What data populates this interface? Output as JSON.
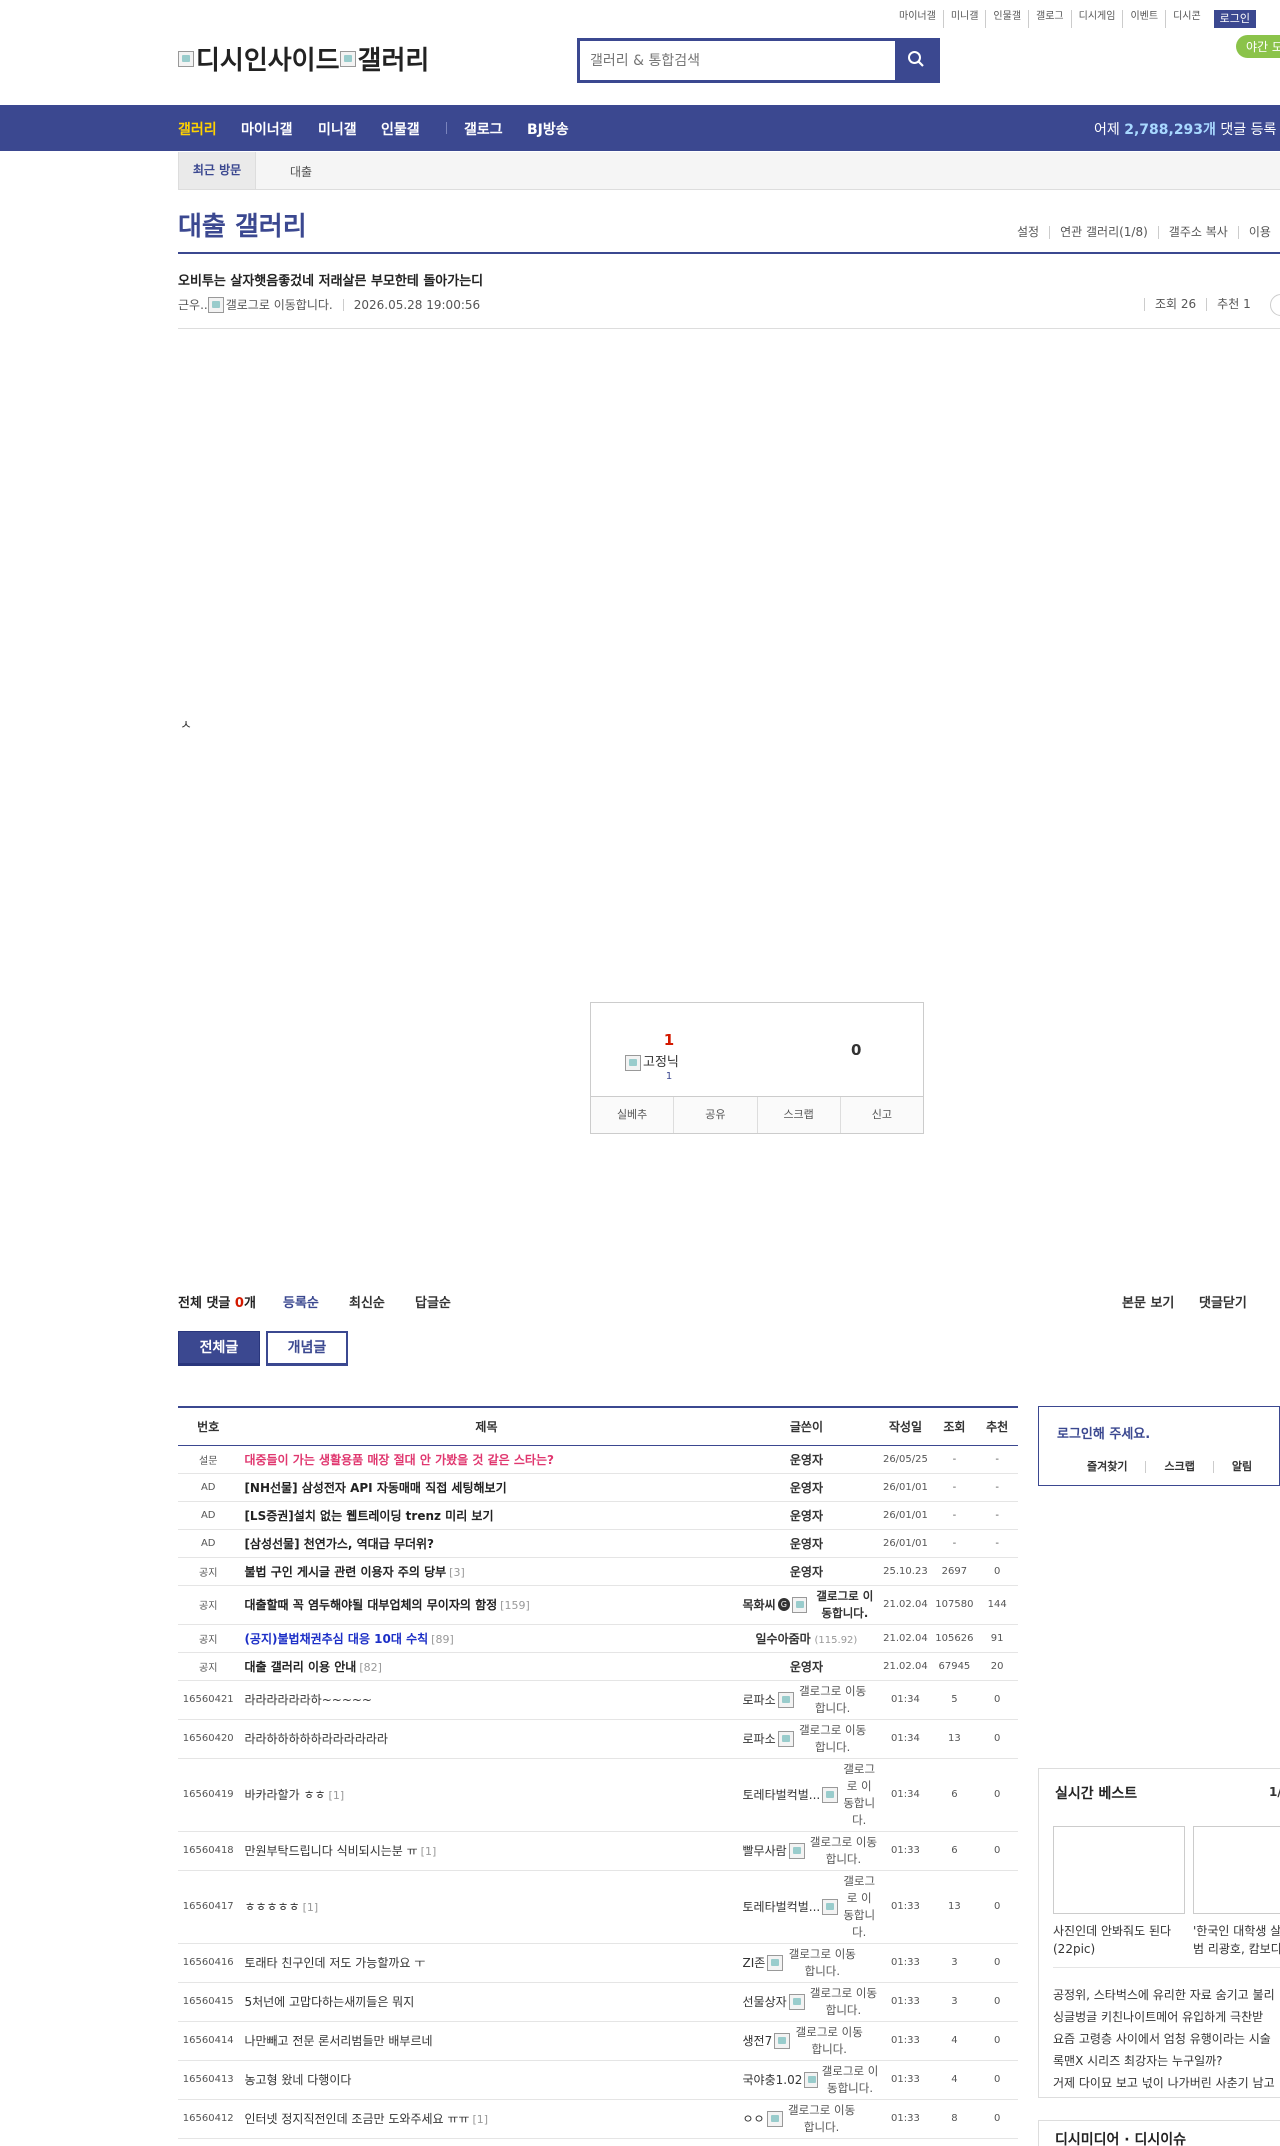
{
  "util_links": [
    "마이너갤",
    "미니갤",
    "인물갤",
    "갤로그",
    "디시게임",
    "이벤트",
    "디시콘"
  ],
  "login_label": "로그인",
  "logo": {
    "alt1": "디시인사이드",
    "alt2": "갤러리"
  },
  "search": {
    "placeholder": "갤러리 & 통합검색"
  },
  "night_mode": "야간 모",
  "gnb": {
    "items": [
      "갤러리",
      "마이너갤",
      "미니갤",
      "인물갤",
      "갤로그",
      "BJ방송"
    ],
    "stat_prefix": "어제",
    "stat_value": "2,788,293개",
    "stat_suffix": "댓글 등록"
  },
  "recent": {
    "label": "최근 방문",
    "items": [
      "대출"
    ]
  },
  "gallery": {
    "title": "대출 갤러리",
    "options": [
      "설정",
      "연관 갤러리(1/8)",
      "갤주소 복사",
      "이용"
    ]
  },
  "post": {
    "title": "오비투는 살자햇음좋겄네 저래살믄 부모한테 돌아가는디",
    "writer": "근우..",
    "writer_icon_alt": "갤로그로 이동합니다.",
    "date": "2026.05.28 19:00:56",
    "views": "조회 26",
    "recommend": "추천 1",
    "body": "ㅅ"
  },
  "vote": {
    "up_count": "1",
    "fixed_alt": "고정닉",
    "fixed_count": "1",
    "down_count": "0",
    "buttons": [
      "실베추",
      "공유",
      "스크랩",
      "신고"
    ]
  },
  "comments": {
    "total_label": "전체 댓글",
    "total_count": "0",
    "total_unit": "개",
    "sorts": [
      "등록순",
      "최신순",
      "답글순"
    ],
    "right": [
      "본문 보기",
      "댓글닫기"
    ]
  },
  "tabs": {
    "all": "전체글",
    "recommend": "개념글"
  },
  "list": {
    "headers": [
      "번호",
      "제목",
      "글쓴이",
      "작성일",
      "조회",
      "추천"
    ],
    "rows": [
      {
        "num": "설문",
        "subject": "대중들이 가는 생활용품 매장 절대 안 가봤을 것 같은 스타는?",
        "reply": "",
        "style": "pink",
        "writer": "운영자",
        "wb": true,
        "ip": "",
        "icon": "",
        "date": "26/05/25",
        "views": "-",
        "rec": "-"
      },
      {
        "num": "AD",
        "subject": "[NH선물] 삼성전자 API 자동매매 직접 세팅해보기",
        "reply": "",
        "style": "b",
        "writer": "운영자",
        "wb": true,
        "ip": "",
        "icon": "",
        "date": "26/01/01",
        "views": "-",
        "rec": "-"
      },
      {
        "num": "AD",
        "subject": "[LS증권]설치 없는 웹트레이딩 trenz 미리 보기",
        "reply": "",
        "style": "b",
        "writer": "운영자",
        "wb": true,
        "ip": "",
        "icon": "",
        "date": "26/01/01",
        "views": "-",
        "rec": "-"
      },
      {
        "num": "AD",
        "subject": "[삼성선물] 천연가스, 역대급 무더위?",
        "reply": "",
        "style": "b",
        "writer": "운영자",
        "wb": true,
        "ip": "",
        "icon": "",
        "date": "26/01/01",
        "views": "-",
        "rec": "-"
      },
      {
        "num": "공지",
        "subject": "불법 구인 게시글 관련 이용자 주의 당부",
        "reply": "[3]",
        "style": "b",
        "writer": "운영자",
        "wb": true,
        "ip": "",
        "icon": "",
        "date": "25.10.23",
        "views": "2697",
        "rec": "0"
      },
      {
        "num": "공지",
        "subject": "대출할때 꼭 염두해야될 대부업체의 무이자의 함정",
        "reply": "[159]",
        "style": "b",
        "writer": "목화씨",
        "wb": true,
        "ip": "",
        "icon": "갤로그로 이동합니다.",
        "iconb": true,
        "date": "21.02.04",
        "views": "107580",
        "rec": "144"
      },
      {
        "num": "공지",
        "subject": "(공지)불법채권추심 대응 10대 수칙",
        "reply": "[89]",
        "style": "blue",
        "writer": "일수아줌마",
        "wb": true,
        "ip": "(115.92)",
        "icon": "",
        "date": "21.02.04",
        "views": "105626",
        "rec": "91"
      },
      {
        "num": "공지",
        "subject": "대출 갤러리 이용 안내",
        "reply": "[82]",
        "style": "b",
        "writer": "운영자",
        "wb": true,
        "ip": "",
        "icon": "",
        "date": "21.02.04",
        "views": "67945",
        "rec": "20"
      },
      {
        "num": "16560421",
        "subject": "라라라라라라하~~~~~",
        "reply": "",
        "style": "",
        "writer": "로파소",
        "wb": false,
        "ip": "",
        "icon": "갤로그로 이동합니다.",
        "date": "01:34",
        "views": "5",
        "rec": "0"
      },
      {
        "num": "16560420",
        "subject": "라라하하하하하라라라라라라",
        "reply": "",
        "style": "",
        "writer": "로파소",
        "wb": false,
        "ip": "",
        "icon": "갤로그로 이동합니다.",
        "date": "01:34",
        "views": "13",
        "rec": "0"
      },
      {
        "num": "16560419",
        "subject": "바카라할가 ㅎㅎ",
        "reply": "[1]",
        "style": "",
        "writer": "토레타벌컥벌...",
        "wb": false,
        "ip": "",
        "icon": "갤로그로 이동합니다.",
        "narrow": true,
        "date": "01:34",
        "views": "6",
        "rec": "0"
      },
      {
        "num": "16560418",
        "subject": "만원부탁드립니다 식비되시는분 ㅠ",
        "reply": "[1]",
        "style": "",
        "writer": "빨무사람",
        "wb": false,
        "ip": "",
        "icon": "갤로그로 이동합니다.",
        "date": "01:33",
        "views": "6",
        "rec": "0"
      },
      {
        "num": "16560417",
        "subject": "ㅎㅎㅎㅎㅎ",
        "reply": "[1]",
        "style": "",
        "writer": "토레타벌컥벌...",
        "wb": false,
        "ip": "",
        "icon": "갤로그로 이동합니다.",
        "narrow": true,
        "date": "01:33",
        "views": "13",
        "rec": "0"
      },
      {
        "num": "16560416",
        "subject": "토래타 친구인데 저도 가능할까요 ㅜ",
        "reply": "",
        "style": "",
        "writer": "ZI존",
        "wb": false,
        "ip": "",
        "icon": "갤로그로 이동합니다.",
        "date": "01:33",
        "views": "3",
        "rec": "0"
      },
      {
        "num": "16560415",
        "subject": "5처넌에 고맙다하는새끼들은 뭐지",
        "reply": "",
        "style": "",
        "writer": "선물상자",
        "wb": false,
        "ip": "",
        "icon": "갤로그로 이동합니다.",
        "date": "01:33",
        "views": "3",
        "rec": "0"
      },
      {
        "num": "16560414",
        "subject": "나만빼고 전문 론서리범들만 배부르네",
        "reply": "",
        "style": "",
        "writer": "생전7",
        "wb": false,
        "ip": "",
        "icon": "갤로그로 이동합니다.",
        "date": "01:33",
        "views": "4",
        "rec": "0"
      },
      {
        "num": "16560413",
        "subject": "농고형 왔네 다행이다",
        "reply": "",
        "style": "",
        "writer": "국야충1.02",
        "wb": false,
        "ip": "",
        "icon": "갤로그로 이동합니다.",
        "date": "01:33",
        "views": "4",
        "rec": "0"
      },
      {
        "num": "16560412",
        "subject": "인터넷 정지직전인데 조금만 도와주세요 ㅠㅠ",
        "reply": "[1]",
        "style": "",
        "writer": "ㅇㅇ",
        "wb": false,
        "ip": "",
        "icon": "갤로그로 이동합니다.",
        "date": "01:33",
        "views": "8",
        "rec": "0"
      }
    ]
  },
  "sidebar": {
    "login_title": "로그인해 주세요.",
    "login_links": [
      "즐겨찾기",
      "스크랩",
      "알림"
    ],
    "best_title": "실시간 베스트",
    "best_page": "1/",
    "best_caps": [
      "사진인데 안봐줘도 된다",
      "(22pic)",
      "'한국인 대학생 살",
      "범 리광호, 캄보디"
    ],
    "best_items": [
      "공정위, 스타벅스에 유리한 자료 숨기고 불리",
      "싱글벙글 키친나이트메어 유입하게 극찬받",
      "요즘 고령층 사이에서 엄청 유행이라는 시술",
      "록맨X 시리즈 최강자는 누구일까?",
      "거제 다이묘 보고 넋이 나가버린 사춘기 남고"
    ],
    "next_title": "디시미디어 · 디시이슈"
  }
}
